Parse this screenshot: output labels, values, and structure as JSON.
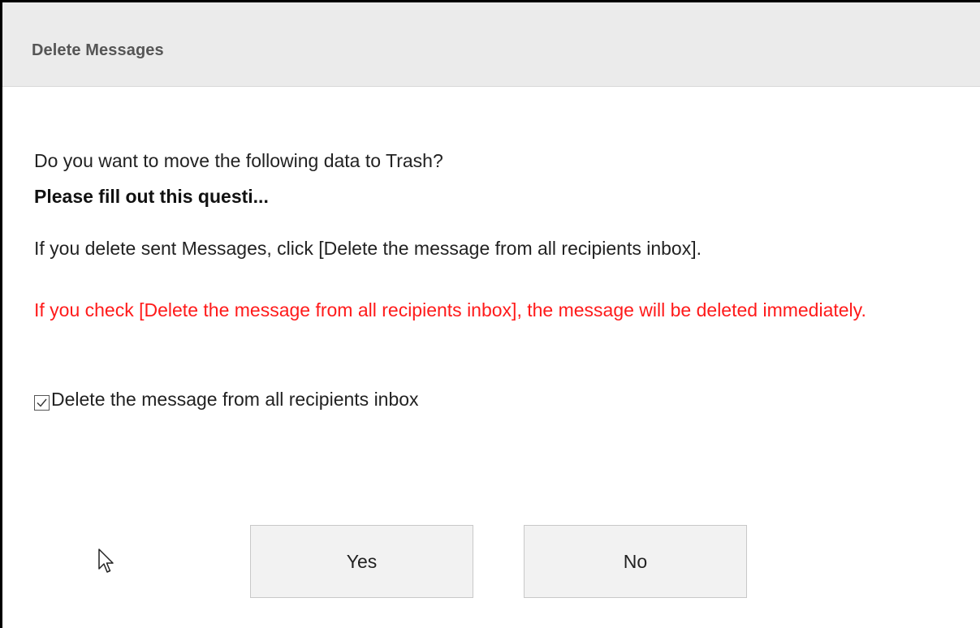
{
  "dialog": {
    "title": "Delete Messages",
    "question": "Do you want to move the following data to Trash?",
    "subject": "Please fill out this questi...",
    "info": "If you delete sent Messages, click [Delete the message from all recipients inbox].",
    "warning": "If you check [Delete the message from all recipients inbox], the message will be deleted immediately.",
    "checkbox": {
      "label": "Delete the message from all recipients inbox",
      "checked": true
    },
    "buttons": {
      "yes_label": "Yes",
      "no_label": "No"
    }
  },
  "colors": {
    "header_bg": "#ebebeb",
    "warning_text": "#ff1a1a",
    "button_bg": "#f2f2f2"
  },
  "icons": {
    "checkbox_mark": "check-icon",
    "pointer": "mouse-cursor-icon"
  }
}
